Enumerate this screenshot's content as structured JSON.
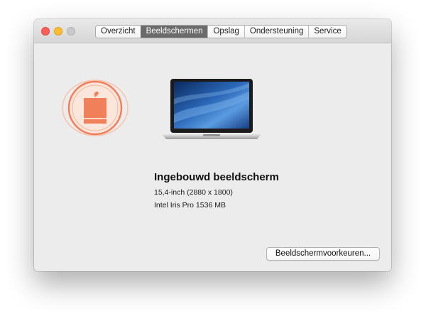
{
  "window": {
    "title": ""
  },
  "tabs": [
    {
      "label": "Overzicht",
      "active": false
    },
    {
      "label": "Beeldschermen",
      "active": true
    },
    {
      "label": "Opslag",
      "active": false
    },
    {
      "label": "Ondersteuning",
      "active": false
    },
    {
      "label": "Service",
      "active": false
    }
  ],
  "display": {
    "name": "Ingebouwd beeldscherm",
    "resolution": "15,4-inch (2880 x 1800)",
    "graphics": "Intel Iris Pro 1536 MB"
  },
  "buttons": {
    "preferences": "Beeldschermvoorkeuren..."
  },
  "icons": {
    "logo": "orange-apple-stamp-logo",
    "device": "macbook-pro-icon",
    "close": "close-icon",
    "minimize": "minimize-icon",
    "zoom": "zoom-icon"
  },
  "colors": {
    "accent_tab": "#6b6b6b",
    "logo_orange": "#f0805a",
    "close": "#fc5f57",
    "minimize": "#fdbc2e"
  }
}
